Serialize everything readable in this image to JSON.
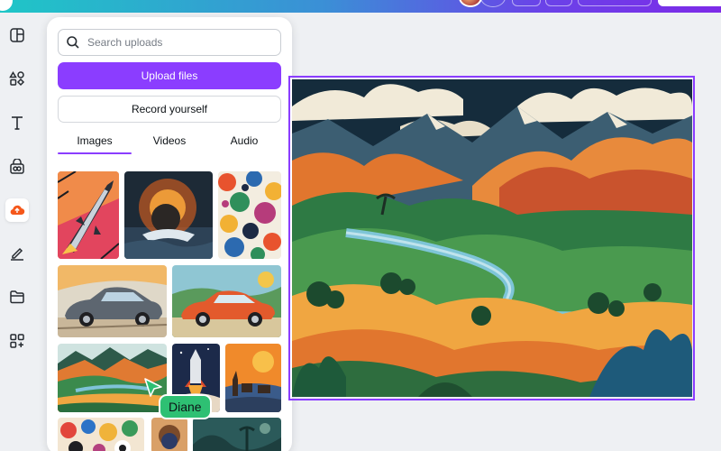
{
  "panel": {
    "search": {
      "placeholder": "Search uploads",
      "value": ""
    },
    "upload_label": "Upload files",
    "record_label": "Record yourself",
    "tabs": [
      {
        "label": "Images",
        "active": true
      },
      {
        "label": "Videos",
        "active": false
      },
      {
        "label": "Audio",
        "active": false
      }
    ]
  },
  "rail": {
    "icons": [
      "design-icon",
      "elements-icon",
      "text-icon",
      "brand-icon",
      "uploads-icon",
      "draw-icon",
      "projects-icon",
      "apps-icon"
    ],
    "active": "uploads-icon"
  },
  "collaborator": {
    "name": "Diane",
    "color": "#2ec073"
  },
  "colors": {
    "accent": "#8b3dff",
    "panel_bg": "#ffffff",
    "page_bg": "#eef0f3"
  }
}
